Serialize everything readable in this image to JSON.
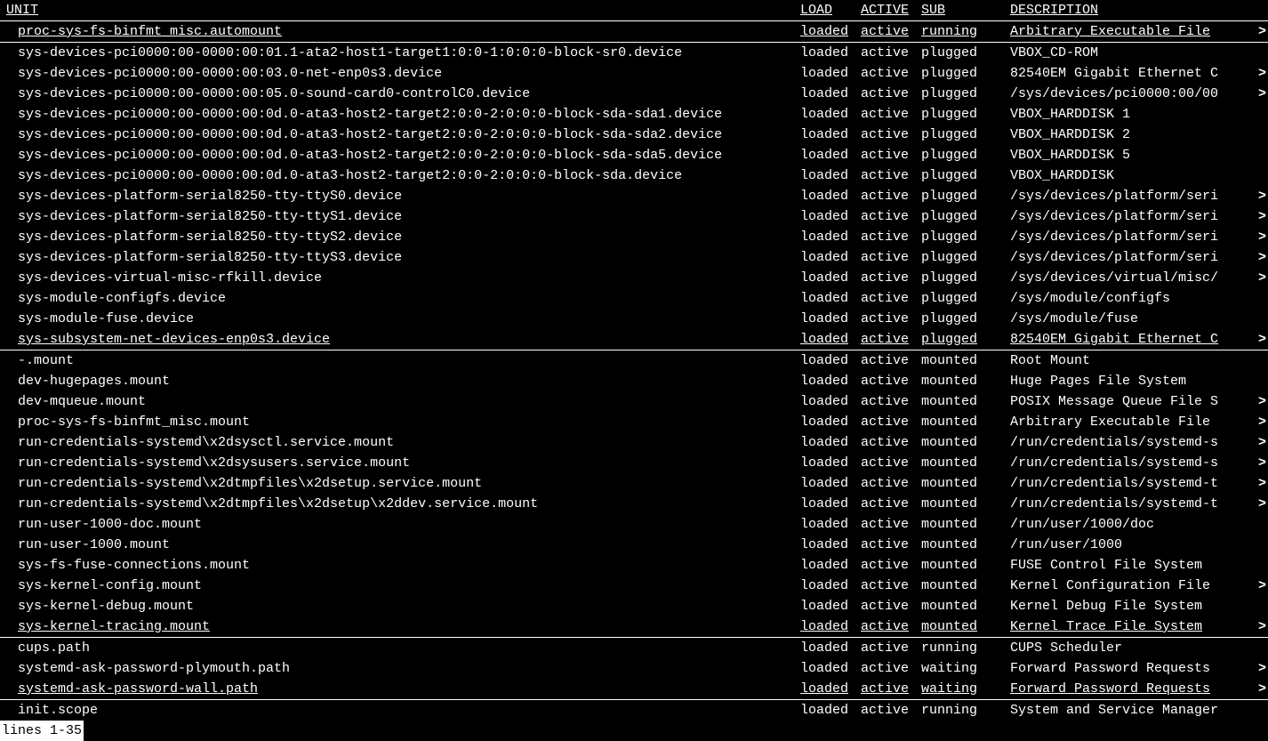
{
  "header": {
    "unit": "UNIT",
    "load": "LOAD",
    "active": "ACTIVE",
    "sub": "SUB",
    "description": "DESCRIPTION"
  },
  "rows": [
    {
      "unit": "proc-sys-fs-binfmt_misc.automount",
      "load": "loaded",
      "active": "active",
      "sub": "running",
      "desc": "Arbitrary Executable File ",
      "gt": true,
      "sep": true
    },
    {
      "unit": "sys-devices-pci0000:00-0000:00:01.1-ata2-host1-target1:0:0-1:0:0:0-block-sr0.device",
      "load": "loaded",
      "active": "active",
      "sub": "plugged",
      "desc": "VBOX_CD-ROM",
      "gt": false,
      "sep": false
    },
    {
      "unit": "sys-devices-pci0000:00-0000:00:03.0-net-enp0s3.device",
      "load": "loaded",
      "active": "active",
      "sub": "plugged",
      "desc": "82540EM Gigabit Ethernet C",
      "gt": true,
      "sep": false
    },
    {
      "unit": "sys-devices-pci0000:00-0000:00:05.0-sound-card0-controlC0.device",
      "load": "loaded",
      "active": "active",
      "sub": "plugged",
      "desc": "/sys/devices/pci0000:00/00",
      "gt": true,
      "sep": false
    },
    {
      "unit": "sys-devices-pci0000:00-0000:00:0d.0-ata3-host2-target2:0:0-2:0:0:0-block-sda-sda1.device",
      "load": "loaded",
      "active": "active",
      "sub": "plugged",
      "desc": "VBOX_HARDDISK 1",
      "gt": false,
      "sep": false
    },
    {
      "unit": "sys-devices-pci0000:00-0000:00:0d.0-ata3-host2-target2:0:0-2:0:0:0-block-sda-sda2.device",
      "load": "loaded",
      "active": "active",
      "sub": "plugged",
      "desc": "VBOX_HARDDISK 2",
      "gt": false,
      "sep": false
    },
    {
      "unit": "sys-devices-pci0000:00-0000:00:0d.0-ata3-host2-target2:0:0-2:0:0:0-block-sda-sda5.device",
      "load": "loaded",
      "active": "active",
      "sub": "plugged",
      "desc": "VBOX_HARDDISK 5",
      "gt": false,
      "sep": false
    },
    {
      "unit": "sys-devices-pci0000:00-0000:00:0d.0-ata3-host2-target2:0:0-2:0:0:0-block-sda.device",
      "load": "loaded",
      "active": "active",
      "sub": "plugged",
      "desc": "VBOX_HARDDISK",
      "gt": false,
      "sep": false
    },
    {
      "unit": "sys-devices-platform-serial8250-tty-ttyS0.device",
      "load": "loaded",
      "active": "active",
      "sub": "plugged",
      "desc": "/sys/devices/platform/seri",
      "gt": true,
      "sep": false
    },
    {
      "unit": "sys-devices-platform-serial8250-tty-ttyS1.device",
      "load": "loaded",
      "active": "active",
      "sub": "plugged",
      "desc": "/sys/devices/platform/seri",
      "gt": true,
      "sep": false
    },
    {
      "unit": "sys-devices-platform-serial8250-tty-ttyS2.device",
      "load": "loaded",
      "active": "active",
      "sub": "plugged",
      "desc": "/sys/devices/platform/seri",
      "gt": true,
      "sep": false
    },
    {
      "unit": "sys-devices-platform-serial8250-tty-ttyS3.device",
      "load": "loaded",
      "active": "active",
      "sub": "plugged",
      "desc": "/sys/devices/platform/seri",
      "gt": true,
      "sep": false
    },
    {
      "unit": "sys-devices-virtual-misc-rfkill.device",
      "load": "loaded",
      "active": "active",
      "sub": "plugged",
      "desc": "/sys/devices/virtual/misc/",
      "gt": true,
      "sep": false
    },
    {
      "unit": "sys-module-configfs.device",
      "load": "loaded",
      "active": "active",
      "sub": "plugged",
      "desc": "/sys/module/configfs",
      "gt": false,
      "sep": false
    },
    {
      "unit": "sys-module-fuse.device",
      "load": "loaded",
      "active": "active",
      "sub": "plugged",
      "desc": "/sys/module/fuse",
      "gt": false,
      "sep": false
    },
    {
      "unit": "sys-subsystem-net-devices-enp0s3.device",
      "load": "loaded",
      "active": "active",
      "sub": "plugged",
      "desc": "82540EM Gigabit Ethernet C",
      "gt": true,
      "sep": true
    },
    {
      "unit": "-.mount",
      "load": "loaded",
      "active": "active",
      "sub": "mounted",
      "desc": "Root Mount",
      "gt": false,
      "sep": false
    },
    {
      "unit": "dev-hugepages.mount",
      "load": "loaded",
      "active": "active",
      "sub": "mounted",
      "desc": "Huge Pages File System",
      "gt": false,
      "sep": false
    },
    {
      "unit": "dev-mqueue.mount",
      "load": "loaded",
      "active": "active",
      "sub": "mounted",
      "desc": "POSIX Message Queue File S",
      "gt": true,
      "sep": false
    },
    {
      "unit": "proc-sys-fs-binfmt_misc.mount",
      "load": "loaded",
      "active": "active",
      "sub": "mounted",
      "desc": "Arbitrary Executable File ",
      "gt": true,
      "sep": false
    },
    {
      "unit": "run-credentials-systemd\\x2dsysctl.service.mount",
      "load": "loaded",
      "active": "active",
      "sub": "mounted",
      "desc": "/run/credentials/systemd-s",
      "gt": true,
      "sep": false
    },
    {
      "unit": "run-credentials-systemd\\x2dsysusers.service.mount",
      "load": "loaded",
      "active": "active",
      "sub": "mounted",
      "desc": "/run/credentials/systemd-s",
      "gt": true,
      "sep": false
    },
    {
      "unit": "run-credentials-systemd\\x2dtmpfiles\\x2dsetup.service.mount",
      "load": "loaded",
      "active": "active",
      "sub": "mounted",
      "desc": "/run/credentials/systemd-t",
      "gt": true,
      "sep": false
    },
    {
      "unit": "run-credentials-systemd\\x2dtmpfiles\\x2dsetup\\x2ddev.service.mount",
      "load": "loaded",
      "active": "active",
      "sub": "mounted",
      "desc": "/run/credentials/systemd-t",
      "gt": true,
      "sep": false
    },
    {
      "unit": "run-user-1000-doc.mount",
      "load": "loaded",
      "active": "active",
      "sub": "mounted",
      "desc": "/run/user/1000/doc",
      "gt": false,
      "sep": false
    },
    {
      "unit": "run-user-1000.mount",
      "load": "loaded",
      "active": "active",
      "sub": "mounted",
      "desc": "/run/user/1000",
      "gt": false,
      "sep": false
    },
    {
      "unit": "sys-fs-fuse-connections.mount",
      "load": "loaded",
      "active": "active",
      "sub": "mounted",
      "desc": "FUSE Control File System",
      "gt": false,
      "sep": false
    },
    {
      "unit": "sys-kernel-config.mount",
      "load": "loaded",
      "active": "active",
      "sub": "mounted",
      "desc": "Kernel Configuration File ",
      "gt": true,
      "sep": false
    },
    {
      "unit": "sys-kernel-debug.mount",
      "load": "loaded",
      "active": "active",
      "sub": "mounted",
      "desc": "Kernel Debug File System",
      "gt": false,
      "sep": false
    },
    {
      "unit": "sys-kernel-tracing.mount",
      "load": "loaded",
      "active": "active",
      "sub": "mounted",
      "desc": "Kernel Trace File System",
      "gt": true,
      "sep": true
    },
    {
      "unit": "cups.path",
      "load": "loaded",
      "active": "active",
      "sub": "running",
      "desc": "CUPS Scheduler",
      "gt": false,
      "sep": false
    },
    {
      "unit": "systemd-ask-password-plymouth.path",
      "load": "loaded",
      "active": "active",
      "sub": "waiting",
      "desc": "Forward Password Requests ",
      "gt": true,
      "sep": false
    },
    {
      "unit": "systemd-ask-password-wall.path",
      "load": "loaded",
      "active": "active",
      "sub": "waiting",
      "desc": "Forward Password Requests ",
      "gt": true,
      "sep": true
    },
    {
      "unit": "init.scope",
      "load": "loaded",
      "active": "active",
      "sub": "running",
      "desc": "System and Service Manager",
      "gt": false,
      "sep": false
    }
  ],
  "status": "lines 1-35"
}
